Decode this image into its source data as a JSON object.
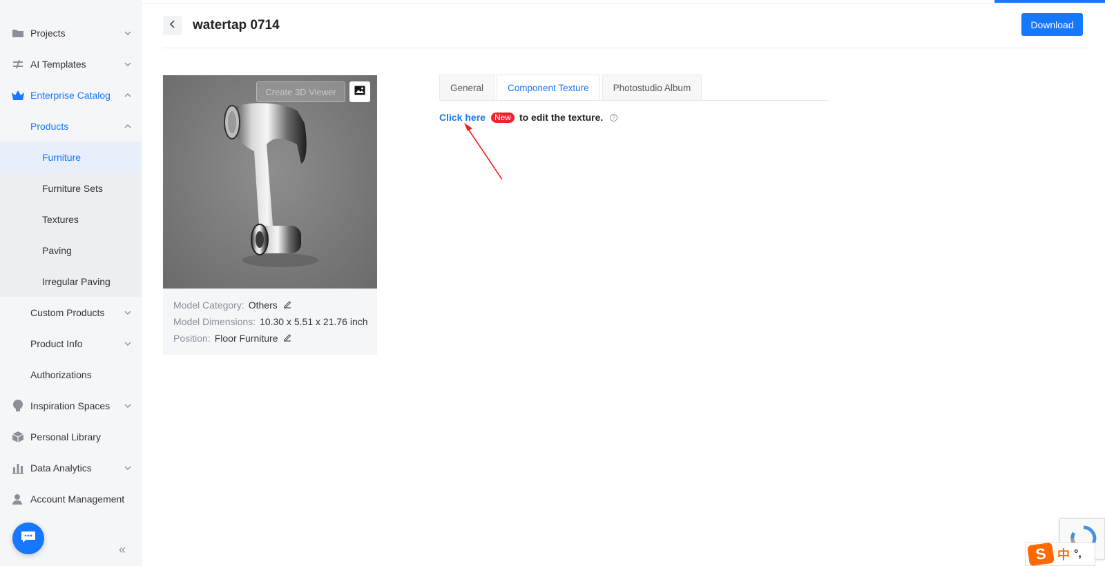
{
  "header": {
    "title": "watertap 0714",
    "download_label": "Download"
  },
  "sidebar": {
    "items": [
      {
        "label": "Projects",
        "icon": "folder-icon"
      },
      {
        "label": "AI Templates",
        "icon": "ai-templates-icon"
      },
      {
        "label": "Enterprise Catalog",
        "icon": "crown-icon"
      },
      {
        "label": "Products"
      },
      {
        "label": "Furniture"
      },
      {
        "label": "Furniture Sets"
      },
      {
        "label": "Textures"
      },
      {
        "label": "Paving"
      },
      {
        "label": "Irregular Paving"
      },
      {
        "label": "Custom Products"
      },
      {
        "label": "Product Info"
      },
      {
        "label": "Authorizations"
      },
      {
        "label": "Inspiration Spaces",
        "icon": "lightbulb-icon"
      },
      {
        "label": "Personal Library",
        "icon": "box-icon"
      },
      {
        "label": "Data Analytics",
        "icon": "bar-chart-icon"
      },
      {
        "label": "Account Management",
        "icon": "user-icon"
      }
    ],
    "collapse_glyph": "«"
  },
  "card": {
    "viewer_label": "Create 3D Viewer",
    "meta": [
      {
        "key": "Model Category:",
        "value": "Others"
      },
      {
        "key": "Model Dimensions:",
        "value": "10.30 x 5.51 x 21.76 inch"
      },
      {
        "key": "Position:",
        "value": "Floor Furniture"
      }
    ]
  },
  "tabs": [
    {
      "label": "General"
    },
    {
      "label": "Component Texture"
    },
    {
      "label": "Photostudio Album"
    }
  ],
  "texture": {
    "link": "Click here",
    "badge": "New",
    "suffix": "to edit the texture.",
    "help": "?"
  },
  "ime": {
    "logo": "S",
    "lang": "中",
    "punct": "°,"
  },
  "colors": {
    "accent": "#1677ff",
    "badge": "#f5222d",
    "annotation_arrow": "#ff0000"
  }
}
